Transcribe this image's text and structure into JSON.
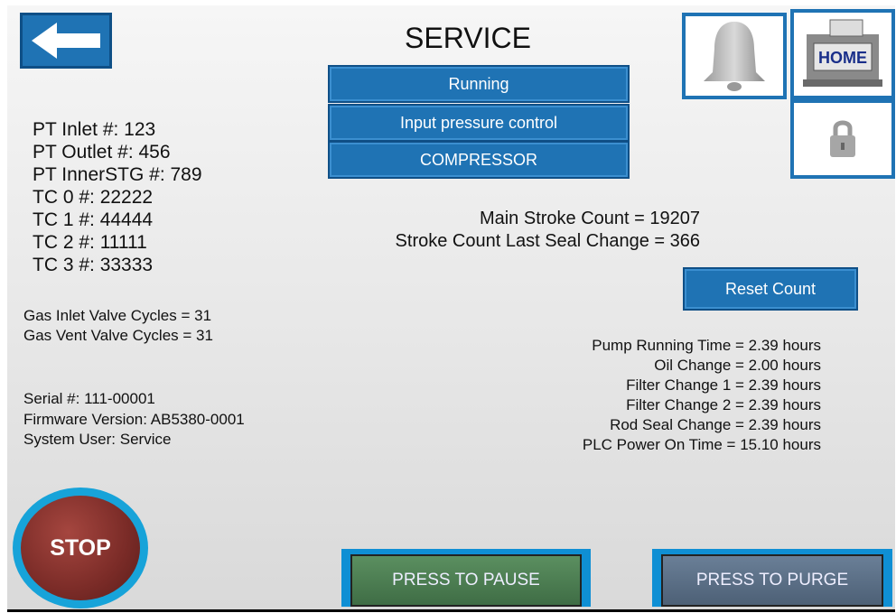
{
  "header": {
    "title": "SERVICE"
  },
  "status_buttons": [
    {
      "label": "Running"
    },
    {
      "label": "Input pressure control"
    },
    {
      "label": "COMPRESSOR"
    }
  ],
  "sensors": [
    {
      "text": "PT Inlet #: 123"
    },
    {
      "text": "PT Outlet #: 456"
    },
    {
      "text": "PT InnerSTG #: 789"
    },
    {
      "text": "TC 0 #: 22222"
    },
    {
      "text": "TC 1 #: 44444"
    },
    {
      "text": "TC 2 #: 11111"
    },
    {
      "text": "TC 3 #: 33333"
    }
  ],
  "valves": [
    {
      "text": "Gas Inlet  Valve Cycles =  31"
    },
    {
      "text": "Gas Vent Valve Cycles =  31"
    }
  ],
  "system_info": [
    {
      "text": "Serial #: 111-00001"
    },
    {
      "text": "Firmware Version: AB5380-0001"
    },
    {
      "text": "System User: Service"
    }
  ],
  "stroke": {
    "main": "Main Stroke Count = 19207",
    "last_seal": "Stroke Count Last Seal Change = 366"
  },
  "reset_button": "Reset Count",
  "maintenance": [
    {
      "text": "Pump Running Time =  2.39 hours"
    },
    {
      "text": "Oil Change =  2.00 hours"
    },
    {
      "text": "Filter Change 1 =  2.39 hours"
    },
    {
      "text": "Filter Change 2 =  2.39 hours"
    },
    {
      "text": "Rod Seal Change =  2.39 hours"
    },
    {
      "text": "PLC Power On Time =  15.10 hours"
    }
  ],
  "home_button": "HOME",
  "stop_button": "STOP",
  "pause_button": "PRESS TO PAUSE",
  "purge_button": "PRESS TO PURGE",
  "icons": {
    "back": "arrow-left-icon",
    "alarm": "bell-icon",
    "home": "home-machine-icon",
    "lock": "lock-icon"
  },
  "colors": {
    "button_blue": "#1f73b4",
    "frame_cyan": "#17a3d9",
    "stop_red": "#7a2b27",
    "pause_green": "#4b7b50",
    "purge_slate": "#556b84"
  }
}
